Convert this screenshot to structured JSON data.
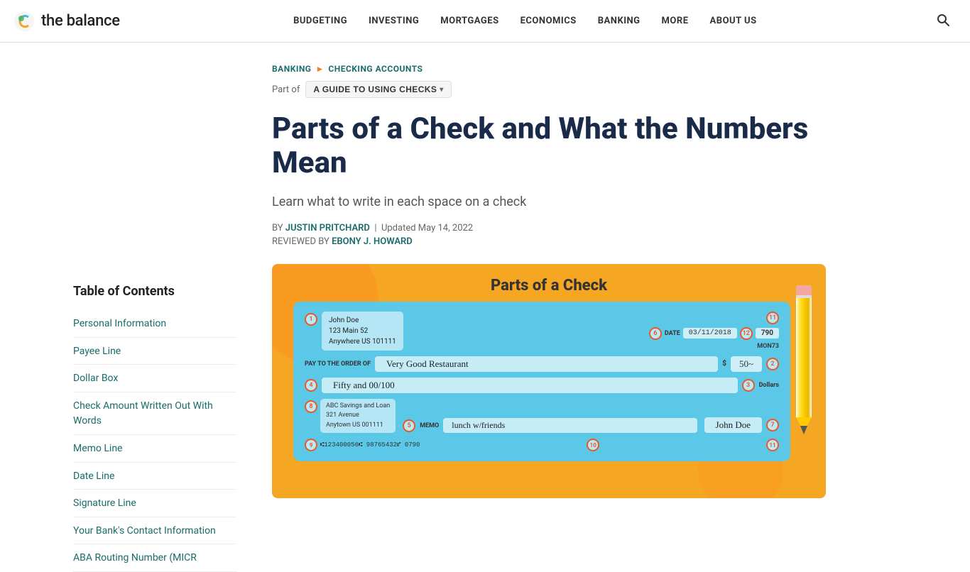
{
  "site": {
    "logo_text": "the balance",
    "nav_items": [
      "BUDGETING",
      "INVESTING",
      "MORTGAGES",
      "ECONOMICS",
      "BANKING",
      "MORE",
      "ABOUT US"
    ]
  },
  "breadcrumb": {
    "items": [
      "BANKING",
      "CHECKING ACCOUNTS"
    ]
  },
  "part_of": {
    "label": "Part of",
    "badge_text": "A GUIDE TO USING CHECKS"
  },
  "article": {
    "title": "Parts of a Check and What the Numbers Mean",
    "subtitle": "Learn what to write in each space on a check",
    "by_label": "BY",
    "author": "JUSTIN PRITCHARD",
    "updated": "Updated May 14, 2022",
    "reviewed_label": "REVIEWED BY",
    "reviewer": "EBONY J. HOWARD"
  },
  "check_image": {
    "title": "Parts of a Check",
    "name": "John Doe",
    "address_line1": "123 Main 52",
    "address_line2": "Anywhere US 101111",
    "date_label": "DATE",
    "date_value": "03/11/2018",
    "check_number": "790",
    "fractional": "MON73",
    "payto_label": "PAY TO THE ORDER OF",
    "payto_value": "Very Good Restaurant",
    "dollar_sign": "$",
    "amount_num": "50~",
    "written_amount": "Fifty and 00/100",
    "dollars_label": "Dollars",
    "bank_name": "ABC Savings and Loan",
    "bank_address1": "321 Avenue",
    "bank_address2": "Anytown US 001111",
    "memo_label": "MEMO",
    "memo_value": "lunch w/friends",
    "signature": "John Doe",
    "micr_line": "⑆123400056⑆  98765432⑈  0790"
  },
  "toc": {
    "title": "Table of Contents",
    "items": [
      "Personal Information",
      "Payee Line",
      "Dollar Box",
      "Check Amount Written Out With Words",
      "Memo Line",
      "Date Line",
      "Signature Line",
      "Your Bank's Contact Information",
      "ABA Routing Number (MICR"
    ]
  },
  "numbers": {
    "n1": "1",
    "n2": "2",
    "n3": "3",
    "n4": "4",
    "n5": "5",
    "n6": "6",
    "n7": "7",
    "n8": "8",
    "n9": "9",
    "n10": "10",
    "n11": "11",
    "n12": "12"
  }
}
